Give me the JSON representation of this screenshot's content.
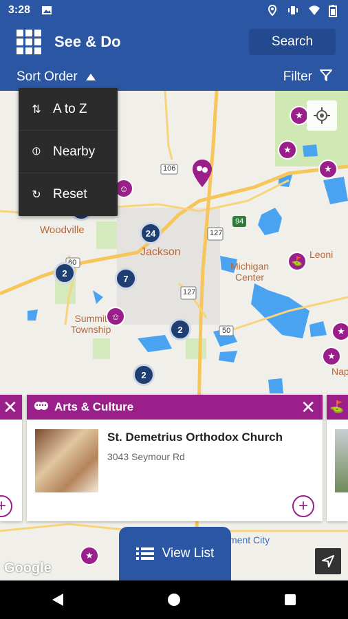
{
  "status": {
    "time": "3:28"
  },
  "appbar": {
    "title": "See & Do",
    "search_label": "Search"
  },
  "filterbar": {
    "sort_label": "Sort Order",
    "filter_label": "Filter"
  },
  "sort_menu": {
    "items": [
      {
        "label": "A to Z",
        "icon": "sort-icon"
      },
      {
        "label": "Nearby",
        "icon": "nearby-icon"
      },
      {
        "label": "Reset",
        "icon": "reset-icon"
      }
    ]
  },
  "map": {
    "labels": {
      "woodville": "Woodville",
      "jackson": "Jackson",
      "michigan_center": "Michigan\nCenter",
      "leoni": "Leoni",
      "summit": "Summit\nTownship",
      "napoleon": "Nap",
      "route_106": "106",
      "route_127a": "127",
      "route_94": "94",
      "route_127b": "127",
      "route_50": "50",
      "route_60": "60",
      "bottom_city": "ment City"
    },
    "clusters": [
      "24",
      "2",
      "7",
      "2",
      "2",
      "2"
    ]
  },
  "card": {
    "category": "Arts & Culture",
    "name": "St. Demetrius Orthodox Church",
    "address": "3043 Seymour Rd"
  },
  "view_list_label": "View List",
  "attribution": "Google",
  "colors": {
    "primary": "#2a56a3",
    "accent": "#9a1f8a",
    "cluster": "#1f3f73"
  }
}
